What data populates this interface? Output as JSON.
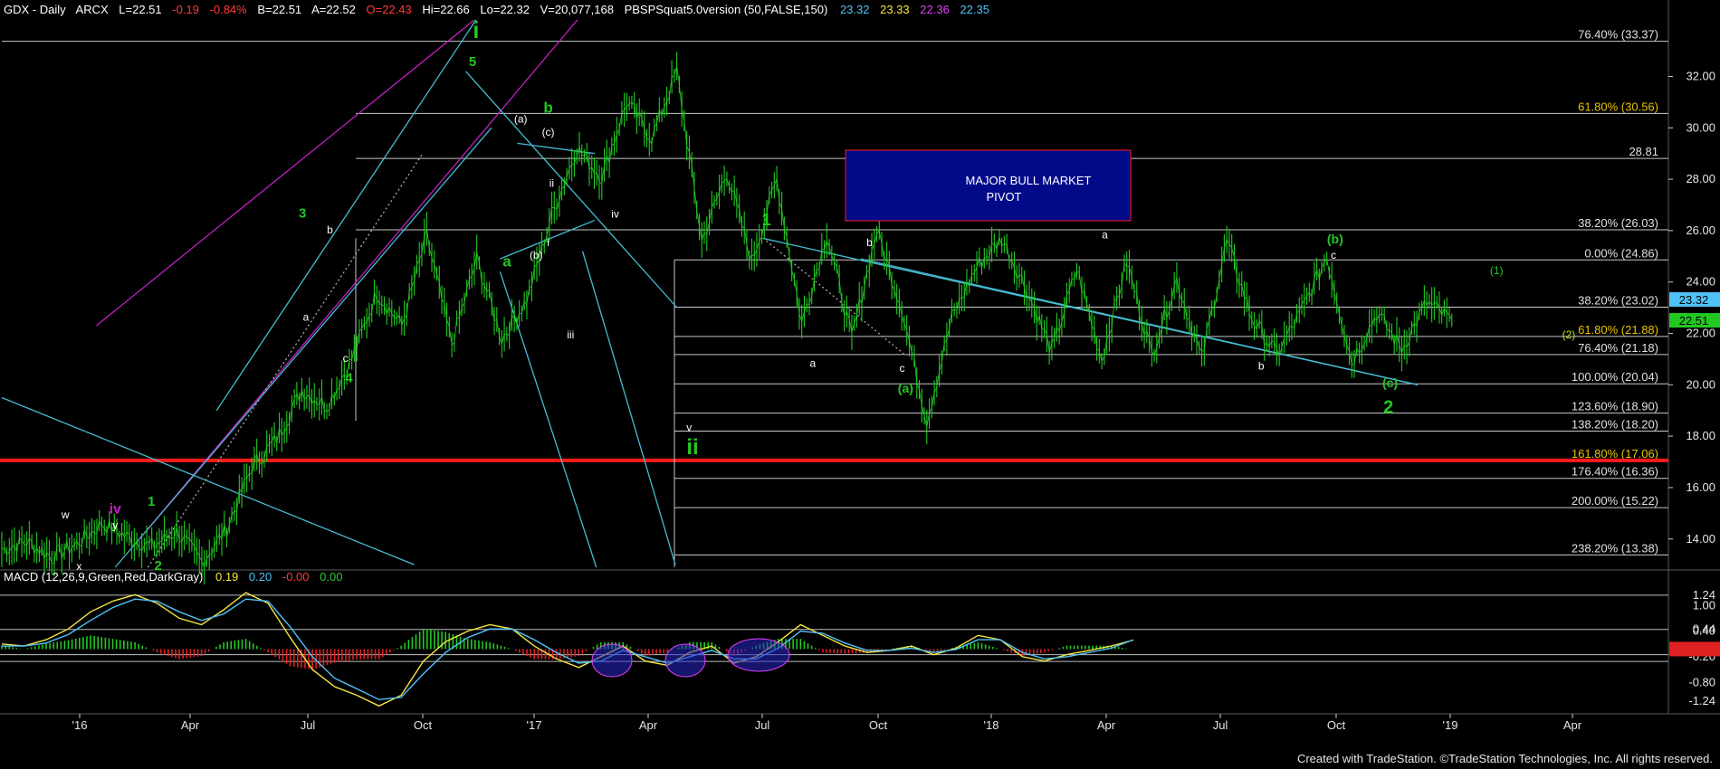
{
  "header": {
    "symbol": "GDX - Daily",
    "exchange": "ARCX",
    "last": "L=22.51",
    "change": "-0.19",
    "change_pct": "-0.84%",
    "bid": "B=22.51",
    "ask": "A=22.52",
    "open": "O=22.43",
    "high": "Hi=22.66",
    "low": "Lo=22.32",
    "volume": "V=20,077,168",
    "study": "PBSPSquat5.0version (50,FALSE,150)",
    "study_values": [
      {
        "text": "23.32",
        "color": "#4fc3f7"
      },
      {
        "text": "23.33",
        "color": "#f5e642"
      },
      {
        "text": "22.36",
        "color": "#e040fb"
      },
      {
        "text": "22.35",
        "color": "#4fc3f7"
      }
    ]
  },
  "macd_header": {
    "label": "MACD (12,26,9,Green,Red,DarkGray)",
    "values": [
      {
        "text": "0.19",
        "color": "#f5e642"
      },
      {
        "text": "0.20",
        "color": "#4fc3f7"
      },
      {
        "text": "-0.00",
        "color": "#ff3b3b"
      },
      {
        "text": "0.00",
        "color": "#34c634"
      }
    ]
  },
  "pivot_box": {
    "line1": "MAJOR BULL MARKET",
    "line2": "PIVOT"
  },
  "footer_text": "Created with TradeStation. ©TradeStation Technologies, Inc. All rights reserved.",
  "colors": {
    "price": "#22c922",
    "fib_line": "#c8c8c8",
    "channel_cyan": "#46bcd2",
    "channel_magenta": "#c21fc2",
    "pivot_red": "#ff1a1a",
    "pivot_box": "#020a8a",
    "fib_label": "#e0e0e0",
    "fib_label_gold": "#e6c200"
  },
  "chart_data": {
    "type": "line",
    "title": "GDX - Daily",
    "x_ticks": [
      "'16",
      "Apr",
      "Jul",
      "Oct",
      "'17",
      "Apr",
      "Jul",
      "Oct",
      "'18",
      "Apr",
      "Jul",
      "Oct",
      "'19",
      "Apr"
    ],
    "price_axis": {
      "ylim": [
        12.9,
        34.2
      ],
      "ticks": [
        "32.00",
        "30.00",
        "28.00",
        "26.00",
        "24.00",
        "22.00",
        "20.00",
        "18.00",
        "16.00",
        "14.00"
      ]
    },
    "price_labels": [
      {
        "text": "23.32",
        "value": 23.32,
        "bg": "#4fc3f7",
        "fg": "#000000"
      },
      {
        "text": "22.51",
        "value": 22.51,
        "bg": "#22c922",
        "fg": "#000000"
      }
    ],
    "series": [
      {
        "x": [
          0,
          10,
          20,
          30,
          40,
          50,
          60,
          70,
          80,
          90,
          100,
          110,
          120,
          130,
          140,
          150,
          160,
          170,
          180,
          190,
          200,
          210,
          220,
          230,
          240,
          250,
          260,
          270,
          280,
          290,
          300,
          310,
          320,
          330,
          340,
          350,
          360,
          370,
          380,
          390,
          400,
          410,
          420,
          430,
          440,
          450,
          460,
          470,
          480,
          490,
          500,
          510,
          520,
          530,
          540,
          550,
          560,
          570,
          580
        ],
        "values": [
          13.6,
          13.9,
          13.3,
          13.8,
          14.6,
          14.1,
          13.7,
          14.3,
          13.1,
          14.4,
          16.8,
          17.9,
          19.8,
          19.2,
          21.0,
          23.6,
          22.3,
          25.8,
          21.6,
          24.9,
          21.8,
          23.3,
          26.6,
          29.2,
          28.1,
          31.0,
          29.6,
          32.2,
          25.6,
          28.3,
          24.8,
          28.0,
          22.4,
          25.9,
          21.8,
          26.0,
          23.0,
          18.6,
          22.6,
          24.6,
          25.7,
          23.7,
          21.3,
          24.5,
          21.0,
          24.8,
          21.2,
          24.1,
          21.0,
          25.6,
          22.6,
          21.2,
          22.9,
          25.0,
          20.9,
          22.8,
          21.4,
          23.2,
          22.51
        ]
      }
    ],
    "fib_levels": [
      {
        "text": "76.40% (33.37)",
        "value": 33.37
      },
      {
        "text": "61.80% (30.56)",
        "value": 30.56
      },
      {
        "text": "28.81",
        "value": 28.81
      },
      {
        "text": "38.20% (26.03)",
        "value": 26.03
      },
      {
        "text": "0.00% (24.86)",
        "value": 24.86
      },
      {
        "text": "38.20% (23.02)",
        "value": 23.02
      },
      {
        "text": "61.80% (21.88)",
        "value": 21.88
      },
      {
        "text": "76.40% (21.18)",
        "value": 21.18
      },
      {
        "text": "100.00% (20.04)",
        "value": 20.04
      },
      {
        "text": "123.60% (18.90)",
        "value": 18.9
      },
      {
        "text": "138.20% (18.20)",
        "value": 18.2
      },
      {
        "text": "161.80% (17.06)",
        "value": 17.06
      },
      {
        "text": "176.40% (16.36)",
        "value": 16.36
      },
      {
        "text": "200.00% (15.22)",
        "value": 15.22
      },
      {
        "text": "238.20% (13.38)",
        "value": 13.38
      }
    ],
    "pivot_level": 17.06,
    "wave_labels": [
      {
        "text": "i",
        "x": 276,
        "value": 33.5,
        "color": "#22c922",
        "size": 26
      },
      {
        "text": "5",
        "x": 274,
        "value": 32.4,
        "color": "#22c922",
        "size": 15
      },
      {
        "text": "(a)",
        "x": 302,
        "value": 30.2,
        "color": "#ffffff",
        "size": 12
      },
      {
        "text": "b",
        "x": 318,
        "value": 30.6,
        "color": "#22c922",
        "size": 17
      },
      {
        "text": "(c)",
        "x": 318,
        "value": 29.7,
        "color": "#ffffff",
        "size": 12
      },
      {
        "text": "ii",
        "x": 320,
        "value": 27.7,
        "color": "#ffffff",
        "size": 12
      },
      {
        "text": "iv",
        "x": 357,
        "value": 26.5,
        "color": "#ffffff",
        "size": 12
      },
      {
        "text": "i",
        "x": 318,
        "value": 25.4,
        "color": "#ffffff",
        "size": 12
      },
      {
        "text": "(b)",
        "x": 311,
        "value": 24.9,
        "color": "#ffffff",
        "size": 12
      },
      {
        "text": "a",
        "x": 294,
        "value": 24.6,
        "color": "#22c922",
        "size": 17
      },
      {
        "text": "iii",
        "x": 331,
        "value": 21.8,
        "color": "#ffffff",
        "size": 12
      },
      {
        "text": "v",
        "x": 400,
        "value": 18.2,
        "color": "#ffffff",
        "size": 12
      },
      {
        "text": "ii",
        "x": 402,
        "value": 17.3,
        "color": "#22c922",
        "size": 24
      },
      {
        "text": "3",
        "x": 175,
        "value": 26.5,
        "color": "#22c922",
        "size": 15
      },
      {
        "text": "b",
        "x": 191,
        "value": 25.9,
        "color": "#ffffff",
        "size": 12
      },
      {
        "text": "a",
        "x": 177,
        "value": 22.5,
        "color": "#ffffff",
        "size": 12
      },
      {
        "text": "c",
        "x": 200,
        "value": 20.9,
        "color": "#ffffff",
        "size": 12
      },
      {
        "text": "4",
        "x": 202,
        "value": 20.1,
        "color": "#22c922",
        "size": 15
      },
      {
        "text": "iv",
        "x": 66,
        "value": 15.0,
        "color": "#c21fc2",
        "size": 16
      },
      {
        "text": "w",
        "x": 37,
        "value": 14.8,
        "color": "#ffffff",
        "size": 12
      },
      {
        "text": "y",
        "x": 66,
        "value": 14.4,
        "color": "#ffffff",
        "size": 12
      },
      {
        "text": "1",
        "x": 87,
        "value": 15.3,
        "color": "#22c922",
        "size": 15
      },
      {
        "text": "x",
        "x": 45,
        "value": 12.8,
        "color": "#ffffff",
        "size": 12
      },
      {
        "text": "2",
        "x": 91,
        "value": 12.8,
        "color": "#22c922",
        "size": 15
      },
      {
        "text": "1",
        "x": 445,
        "value": 26.2,
        "color": "#22c922",
        "size": 18
      },
      {
        "text": "b",
        "x": 505,
        "value": 25.4,
        "color": "#ffffff",
        "size": 12
      },
      {
        "text": "a",
        "x": 472,
        "value": 20.7,
        "color": "#ffffff",
        "size": 12
      },
      {
        "text": "c",
        "x": 524,
        "value": 20.5,
        "color": "#ffffff",
        "size": 12
      },
      {
        "text": "(a)",
        "x": 526,
        "value": 19.7,
        "color": "#22c922",
        "size": 14
      },
      {
        "text": "a",
        "x": 642,
        "value": 25.7,
        "color": "#ffffff",
        "size": 12
      },
      {
        "text": "(b)",
        "x": 776,
        "value": 25.5,
        "color": "#22c922",
        "size": 14
      },
      {
        "text": "c",
        "x": 775,
        "value": 24.9,
        "color": "#ffffff",
        "size": 12
      },
      {
        "text": "b",
        "x": 733,
        "value": 20.6,
        "color": "#ffffff",
        "size": 12
      },
      {
        "text": "(c)",
        "x": 808,
        "value": 19.9,
        "color": "#22c922",
        "size": 14
      },
      {
        "text": "2",
        "x": 807,
        "value": 18.9,
        "color": "#22c922",
        "size": 20
      },
      {
        "text": "(1)",
        "x": 870,
        "value": 24.3,
        "color": "#22c922",
        "size": 12
      },
      {
        "text": "(2)",
        "x": 912,
        "value": 21.8,
        "color": "#c8e61a",
        "size": 12
      }
    ],
    "macd": {
      "ylim": [
        -1.45,
        1.45
      ],
      "ticks": [
        "1.24",
        "1.00",
        "0.44",
        "0.40",
        "-0.20",
        "-0.80",
        "-1.24"
      ],
      "macd_line": [
        0.1,
        0.05,
        0.2,
        0.45,
        0.85,
        1.1,
        1.25,
        1.05,
        0.7,
        0.55,
        0.9,
        1.3,
        1.05,
        0.25,
        -0.5,
        -0.9,
        -1.1,
        -1.35,
        -1.1,
        -0.3,
        0.15,
        0.4,
        0.55,
        0.45,
        0.05,
        -0.25,
        -0.45,
        -0.2,
        0.05,
        -0.3,
        -0.4,
        -0.1,
        0.05,
        -0.35,
        -0.2,
        0.15,
        0.55,
        0.3,
        0.05,
        -0.1,
        -0.05,
        0.05,
        -0.15,
        0.0,
        0.3,
        0.2,
        -0.2,
        -0.3,
        -0.15,
        -0.05,
        0.05,
        0.19
      ],
      "signal_line": [
        0.05,
        0.05,
        0.12,
        0.32,
        0.65,
        0.95,
        1.15,
        1.1,
        0.85,
        0.65,
        0.8,
        1.15,
        1.1,
        0.5,
        -0.2,
        -0.7,
        -0.95,
        -1.2,
        -1.15,
        -0.6,
        -0.1,
        0.25,
        0.45,
        0.45,
        0.2,
        -0.1,
        -0.35,
        -0.3,
        -0.05,
        -0.2,
        -0.35,
        -0.2,
        -0.05,
        -0.25,
        -0.25,
        0.0,
        0.4,
        0.35,
        0.12,
        -0.05,
        -0.05,
        0.0,
        -0.1,
        -0.03,
        0.2,
        0.2,
        -0.1,
        -0.25,
        -0.2,
        -0.1,
        0.0,
        0.2
      ]
    }
  }
}
